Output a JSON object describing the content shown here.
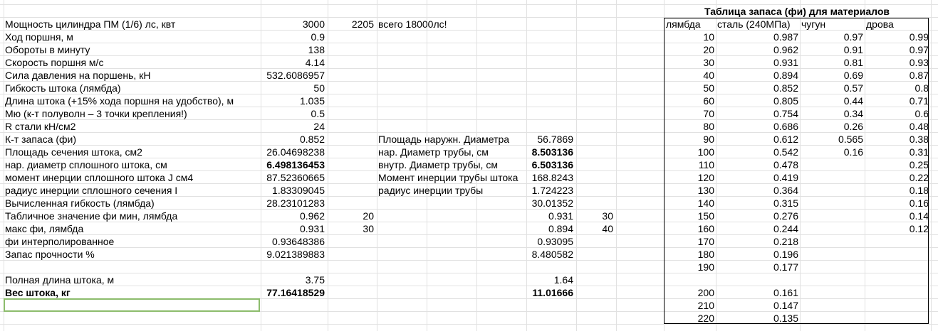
{
  "left_rows": [
    {
      "label": "Мощность цилиндра ПМ (1/6) лс, квт",
      "value": "3000",
      "c3": "2205",
      "c4": "всего 18000лс!"
    },
    {
      "label": "Ход поршня, м",
      "value": "0.9"
    },
    {
      "label": "Обороты в минуту",
      "value": "138"
    },
    {
      "label": "Скорость поршня м/с",
      "value": "4.14"
    },
    {
      "label": "Сила давления на поршень, кН",
      "value": "532.6086957"
    },
    {
      "label": "Гибкость штока (лямбда)",
      "value": "50"
    },
    {
      "label": "Длина штока (+15% хода поршня на удобство), м",
      "value": "1.035"
    },
    {
      "label": "Мю (к-т полуволн – 3 точки крепления!)",
      "value": "0.5"
    },
    {
      "label": "R стали кН/см2",
      "value": "24"
    },
    {
      "label": "К-т запаса (фи)",
      "value": "0.852",
      "c4": "Площадь наружн. Диаметра",
      "c5": "56.7869"
    },
    {
      "label": "Площадь сечения штока, см2",
      "value": "26.04698238",
      "c4": "нар. Диаметр трубы, см",
      "c5": "8.503136",
      "c5b": true
    },
    {
      "label": "нар. диаметр сплошного штока, см",
      "value": "6.498136453",
      "vb": true,
      "c4": "внутр. Диаметр трубы, см",
      "c5": "6.503136",
      "c5b": true
    },
    {
      "label": "момент инерции сплошного штока J см4",
      "value": "87.52360665",
      "c4": "Момент инерции трубы штока",
      "c5": "168.8243"
    },
    {
      "label": "радиус инерции сплошного сечения I",
      "value": "1.83309045",
      "c4": "радиус инерции трубы",
      "c5": "1.724223"
    },
    {
      "label": "Вычисленная гибкость (лямбда)",
      "value": "28.23101283",
      "c5": "30.01352"
    },
    {
      "label": "Табличное значение фи мин, лямбда",
      "value": "0.962",
      "c3": "20",
      "c5": "0.931",
      "c6": "30"
    },
    {
      "label": "макс фи, лямбда",
      "value": "0.931",
      "c3": "30",
      "c5": "0.894",
      "c6": "40"
    },
    {
      "label": "фи интерполированное",
      "value": "0.93648386",
      "c5": "0.93095"
    },
    {
      "label": "Запас прочности %",
      "value": "9.021389883",
      "c5": "8.480582"
    },
    {
      "label": "",
      "value": ""
    },
    {
      "label": "Полная длина штока, м",
      "value": "3.75",
      "c5": "1.64"
    },
    {
      "label": "Вес штока, кг",
      "value": "77.16418529",
      "lb": true,
      "vb": true,
      "c5": "11.01666",
      "c5b": true
    }
  ],
  "phi_table": {
    "title": "Таблица запаса (фи) для материалов",
    "headers": [
      "лямбда",
      "сталь (240МПа)",
      "чугун",
      "дрова"
    ],
    "rows": [
      [
        "10",
        "0.987",
        "0.97",
        "0.99"
      ],
      [
        "20",
        "0.962",
        "0.91",
        "0.97"
      ],
      [
        "30",
        "0.931",
        "0.81",
        "0.93"
      ],
      [
        "40",
        "0.894",
        "0.69",
        "0.87"
      ],
      [
        "50",
        "0.852",
        "0.57",
        "0.8"
      ],
      [
        "60",
        "0.805",
        "0.44",
        "0.71"
      ],
      [
        "70",
        "0.754",
        "0.34",
        "0.6"
      ],
      [
        "80",
        "0.686",
        "0.26",
        "0.48"
      ],
      [
        "90",
        "0.612",
        "0.565",
        "0.38"
      ],
      [
        "100",
        "0.542",
        "0.16",
        "0.31"
      ],
      [
        "110",
        "0.478",
        "",
        "0.25"
      ],
      [
        "120",
        "0.419",
        "",
        "0.22"
      ],
      [
        "130",
        "0.364",
        "",
        "0.18"
      ],
      [
        "140",
        "0.315",
        "",
        "0.16"
      ],
      [
        "150",
        "0.276",
        "",
        "0.14"
      ],
      [
        "160",
        "0.244",
        "",
        "0.12"
      ],
      [
        "170",
        "0.218",
        "",
        ""
      ],
      [
        "180",
        "0.196",
        "",
        ""
      ],
      [
        "190",
        "0.177",
        "",
        ""
      ],
      [
        "",
        "",
        "",
        ""
      ],
      [
        "200",
        "0.161",
        "",
        ""
      ],
      [
        "210",
        "0.147",
        "",
        ""
      ],
      [
        "220",
        "0.135",
        "",
        ""
      ]
    ]
  },
  "colors": {
    "grid": "#e1e1e1",
    "selection": "#8cbc6c",
    "table_border": "#000000"
  }
}
